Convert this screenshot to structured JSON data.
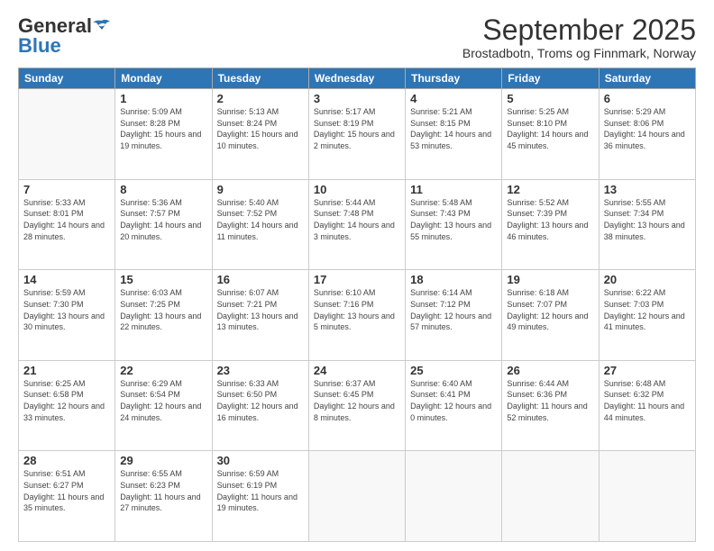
{
  "header": {
    "logo_general": "General",
    "logo_blue": "Blue",
    "title": "September 2025",
    "subtitle": "Brostadbotn, Troms og Finnmark, Norway"
  },
  "days_of_week": [
    "Sunday",
    "Monday",
    "Tuesday",
    "Wednesday",
    "Thursday",
    "Friday",
    "Saturday"
  ],
  "weeks": [
    [
      {
        "day": "",
        "empty": true
      },
      {
        "day": "1",
        "rise": "Sunrise: 5:09 AM",
        "set": "Sunset: 8:28 PM",
        "light": "Daylight: 15 hours and 19 minutes."
      },
      {
        "day": "2",
        "rise": "Sunrise: 5:13 AM",
        "set": "Sunset: 8:24 PM",
        "light": "Daylight: 15 hours and 10 minutes."
      },
      {
        "day": "3",
        "rise": "Sunrise: 5:17 AM",
        "set": "Sunset: 8:19 PM",
        "light": "Daylight: 15 hours and 2 minutes."
      },
      {
        "day": "4",
        "rise": "Sunrise: 5:21 AM",
        "set": "Sunset: 8:15 PM",
        "light": "Daylight: 14 hours and 53 minutes."
      },
      {
        "day": "5",
        "rise": "Sunrise: 5:25 AM",
        "set": "Sunset: 8:10 PM",
        "light": "Daylight: 14 hours and 45 minutes."
      },
      {
        "day": "6",
        "rise": "Sunrise: 5:29 AM",
        "set": "Sunset: 8:06 PM",
        "light": "Daylight: 14 hours and 36 minutes."
      }
    ],
    [
      {
        "day": "7",
        "rise": "Sunrise: 5:33 AM",
        "set": "Sunset: 8:01 PM",
        "light": "Daylight: 14 hours and 28 minutes."
      },
      {
        "day": "8",
        "rise": "Sunrise: 5:36 AM",
        "set": "Sunset: 7:57 PM",
        "light": "Daylight: 14 hours and 20 minutes."
      },
      {
        "day": "9",
        "rise": "Sunrise: 5:40 AM",
        "set": "Sunset: 7:52 PM",
        "light": "Daylight: 14 hours and 11 minutes."
      },
      {
        "day": "10",
        "rise": "Sunrise: 5:44 AM",
        "set": "Sunset: 7:48 PM",
        "light": "Daylight: 14 hours and 3 minutes."
      },
      {
        "day": "11",
        "rise": "Sunrise: 5:48 AM",
        "set": "Sunset: 7:43 PM",
        "light": "Daylight: 13 hours and 55 minutes."
      },
      {
        "day": "12",
        "rise": "Sunrise: 5:52 AM",
        "set": "Sunset: 7:39 PM",
        "light": "Daylight: 13 hours and 46 minutes."
      },
      {
        "day": "13",
        "rise": "Sunrise: 5:55 AM",
        "set": "Sunset: 7:34 PM",
        "light": "Daylight: 13 hours and 38 minutes."
      }
    ],
    [
      {
        "day": "14",
        "rise": "Sunrise: 5:59 AM",
        "set": "Sunset: 7:30 PM",
        "light": "Daylight: 13 hours and 30 minutes."
      },
      {
        "day": "15",
        "rise": "Sunrise: 6:03 AM",
        "set": "Sunset: 7:25 PM",
        "light": "Daylight: 13 hours and 22 minutes."
      },
      {
        "day": "16",
        "rise": "Sunrise: 6:07 AM",
        "set": "Sunset: 7:21 PM",
        "light": "Daylight: 13 hours and 13 minutes."
      },
      {
        "day": "17",
        "rise": "Sunrise: 6:10 AM",
        "set": "Sunset: 7:16 PM",
        "light": "Daylight: 13 hours and 5 minutes."
      },
      {
        "day": "18",
        "rise": "Sunrise: 6:14 AM",
        "set": "Sunset: 7:12 PM",
        "light": "Daylight: 12 hours and 57 minutes."
      },
      {
        "day": "19",
        "rise": "Sunrise: 6:18 AM",
        "set": "Sunset: 7:07 PM",
        "light": "Daylight: 12 hours and 49 minutes."
      },
      {
        "day": "20",
        "rise": "Sunrise: 6:22 AM",
        "set": "Sunset: 7:03 PM",
        "light": "Daylight: 12 hours and 41 minutes."
      }
    ],
    [
      {
        "day": "21",
        "rise": "Sunrise: 6:25 AM",
        "set": "Sunset: 6:58 PM",
        "light": "Daylight: 12 hours and 33 minutes."
      },
      {
        "day": "22",
        "rise": "Sunrise: 6:29 AM",
        "set": "Sunset: 6:54 PM",
        "light": "Daylight: 12 hours and 24 minutes."
      },
      {
        "day": "23",
        "rise": "Sunrise: 6:33 AM",
        "set": "Sunset: 6:50 PM",
        "light": "Daylight: 12 hours and 16 minutes."
      },
      {
        "day": "24",
        "rise": "Sunrise: 6:37 AM",
        "set": "Sunset: 6:45 PM",
        "light": "Daylight: 12 hours and 8 minutes."
      },
      {
        "day": "25",
        "rise": "Sunrise: 6:40 AM",
        "set": "Sunset: 6:41 PM",
        "light": "Daylight: 12 hours and 0 minutes."
      },
      {
        "day": "26",
        "rise": "Sunrise: 6:44 AM",
        "set": "Sunset: 6:36 PM",
        "light": "Daylight: 11 hours and 52 minutes."
      },
      {
        "day": "27",
        "rise": "Sunrise: 6:48 AM",
        "set": "Sunset: 6:32 PM",
        "light": "Daylight: 11 hours and 44 minutes."
      }
    ],
    [
      {
        "day": "28",
        "rise": "Sunrise: 6:51 AM",
        "set": "Sunset: 6:27 PM",
        "light": "Daylight: 11 hours and 35 minutes."
      },
      {
        "day": "29",
        "rise": "Sunrise: 6:55 AM",
        "set": "Sunset: 6:23 PM",
        "light": "Daylight: 11 hours and 27 minutes."
      },
      {
        "day": "30",
        "rise": "Sunrise: 6:59 AM",
        "set": "Sunset: 6:19 PM",
        "light": "Daylight: 11 hours and 19 minutes."
      },
      {
        "day": "",
        "empty": true
      },
      {
        "day": "",
        "empty": true
      },
      {
        "day": "",
        "empty": true
      },
      {
        "day": "",
        "empty": true
      }
    ]
  ]
}
